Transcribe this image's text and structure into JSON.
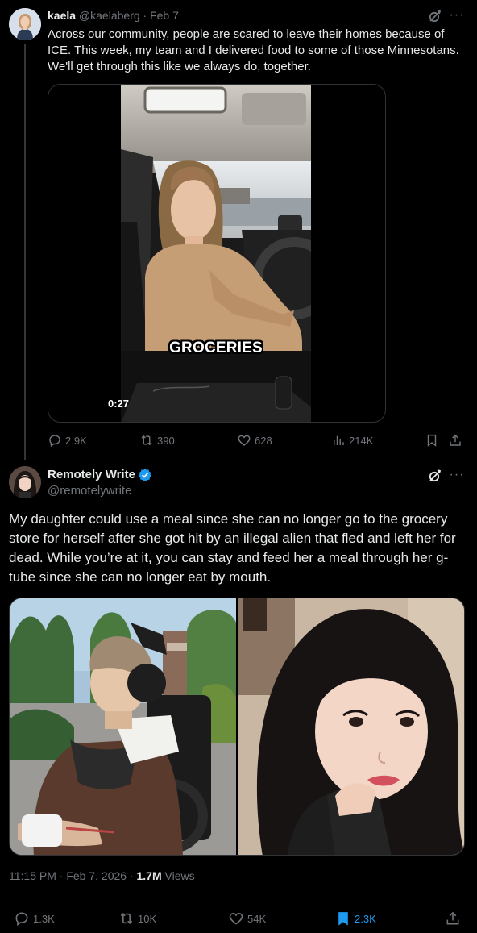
{
  "tweet1": {
    "name": "kaela",
    "handle": "@kaelaberg",
    "separator": "·",
    "date": "Feb 7",
    "text": "Across our community, people are scared to leave their homes because of ICE. This week, my team and I delivered food to some of those Minnesotans. We'll get through this like we always do, together.",
    "video": {
      "caption": "GROCERIES",
      "duration": "0:27"
    },
    "stats": {
      "replies": "2.9K",
      "reposts": "390",
      "likes": "628",
      "views": "214K"
    }
  },
  "tweet2": {
    "name": "Remotely Write",
    "handle": "@remotelywrite",
    "verified": true,
    "text": "My daughter could use a meal since she can no longer go to the grocery store for herself after she got hit by an illegal alien that fled and left her for dead. While you’re at it, you can stay and feed her a meal through her g-tube since she can no longer eat by mouth.",
    "time": "11:15 PM · Feb 7, 2026 · ",
    "views_count": "1.7M",
    "views_label": " Views",
    "stats": {
      "replies": "1.3K",
      "reposts": "10K",
      "likes": "54K",
      "bookmarks": "2.3K"
    }
  },
  "colors": {
    "background": "#000000",
    "text": "#e7e9ea",
    "muted": "#71767b",
    "accent": "#1d9bf0",
    "border": "#2f3336"
  },
  "icons": [
    "grok-icon",
    "more-icon",
    "reply-icon",
    "repost-icon",
    "like-icon",
    "views-icon",
    "bookmark-icon",
    "share-icon",
    "verified-badge-icon"
  ]
}
